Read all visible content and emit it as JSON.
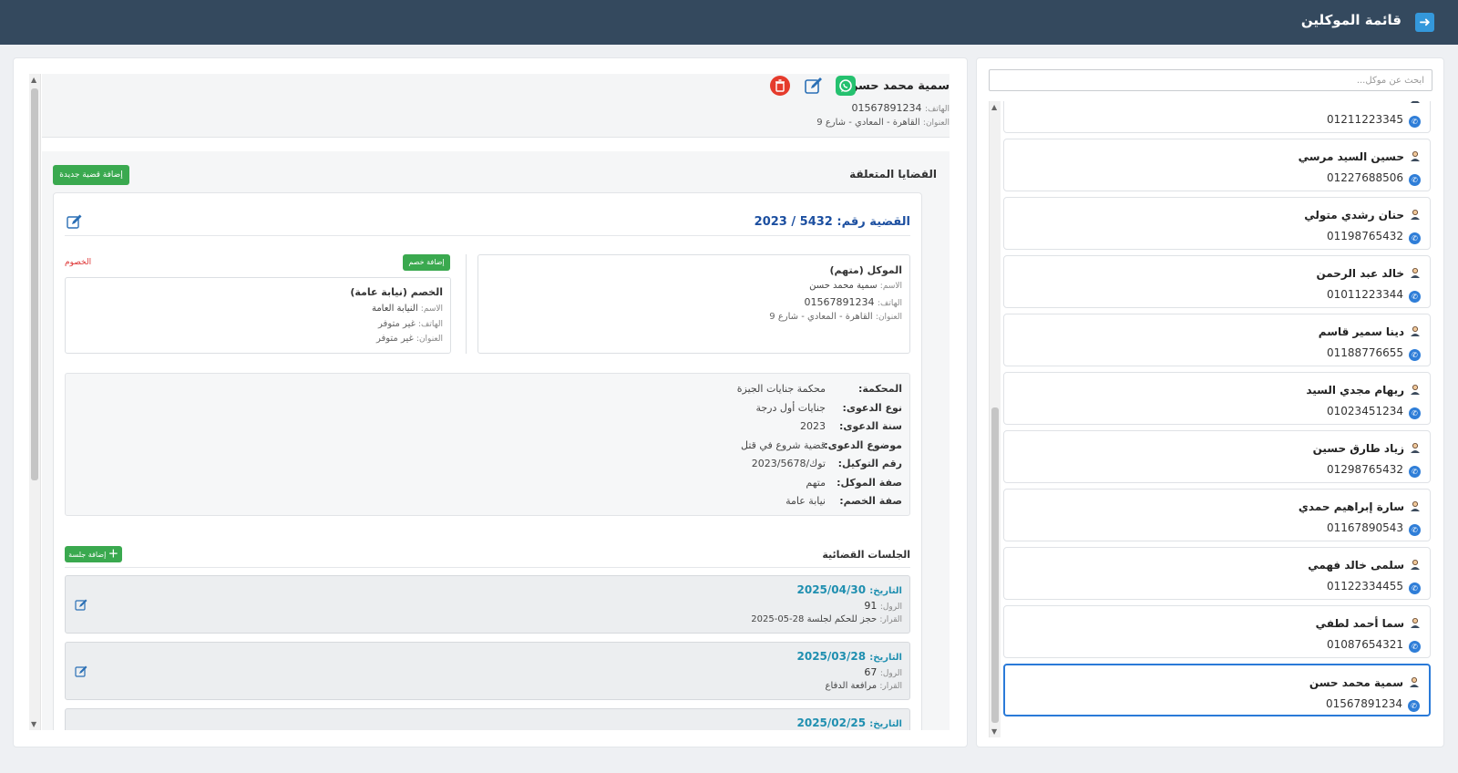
{
  "header": {
    "title": "قائمة الموكلين",
    "logout_icon": "logout-icon"
  },
  "sidebar": {
    "search_placeholder": "ابحث عن موكل...",
    "clients": [
      {
        "name": "",
        "phone": "01211223345"
      },
      {
        "name": "حسين السيد مرسي",
        "phone": "01227688506"
      },
      {
        "name": "حنان رشدي متولي",
        "phone": "01198765432"
      },
      {
        "name": "خالد عبد الرحمن",
        "phone": "01011223344"
      },
      {
        "name": "دينا سمير قاسم",
        "phone": "01188776655"
      },
      {
        "name": "ريهام مجدي السيد",
        "phone": "01023451234"
      },
      {
        "name": "زياد طارق حسين",
        "phone": "01298765432"
      },
      {
        "name": "سارة إبراهيم حمدي",
        "phone": "01167890543"
      },
      {
        "name": "سلمى خالد فهمي",
        "phone": "01122334455"
      },
      {
        "name": "سما أحمد لطفي",
        "phone": "01087654321"
      },
      {
        "name": "سمية محمد حسن",
        "phone": "01567891234",
        "active": true
      }
    ]
  },
  "client": {
    "name": "سمية محمد حسن",
    "phone_label": "الهاتف:",
    "phone": "01567891234",
    "address_label": "العنوان:",
    "address": "القاهرة - المعادي - شارع 9"
  },
  "cases_section": {
    "title": "القضايا المتعلقة",
    "add_case_label": "إضافة قضية جديدة",
    "case": {
      "title_prefix": "القضية رقم:",
      "number": "5432 / 2023",
      "client_box": {
        "title": "الموكل (متهم)",
        "name_label": "الاسم:",
        "name": "سمية محمد حسن",
        "phone_label": "الهاتف:",
        "phone": "01567891234",
        "address_label": "العنوان:",
        "address": "القاهرة - المعادي - شارع 9"
      },
      "opponents_title": "الخصوم",
      "add_opponent_label": "إضافة خصم",
      "opponent_box": {
        "title": "الخصم (نيابة عامة)",
        "name_label": "الاسم:",
        "name": "النيابة العامة",
        "phone_label": "الهاتف:",
        "phone": "غير متوفر",
        "address_label": "العنوان:",
        "address": "غير متوفر"
      },
      "details": [
        {
          "key": "المحكمة:",
          "value": "محكمة جنايات الجيزة"
        },
        {
          "key": "نوع الدعوى:",
          "value": "جنايات أول درجة"
        },
        {
          "key": "سنة الدعوى:",
          "value": "2023"
        },
        {
          "key": "موضوع الدعوى:",
          "value": "قضية شروع في قتل"
        },
        {
          "key": "رقم التوكيل:",
          "value": "توك/2023/5678"
        },
        {
          "key": "صفة الموكل:",
          "value": "متهم"
        },
        {
          "key": "صفة الخصم:",
          "value": "نيابة عامة"
        }
      ],
      "sessions_title": "الجلسات القضائية",
      "add_session_label": "إضافة جلسة",
      "sessions": [
        {
          "date_label": "التاريخ:",
          "date": "2025/04/30",
          "roll_label": "الرول:",
          "roll": "91",
          "decision_label": "القرار:",
          "decision": "حجز للحكم لجلسة 28-05-2025"
        },
        {
          "date_label": "التاريخ:",
          "date": "2025/03/28",
          "roll_label": "الرول:",
          "roll": "67",
          "decision_label": "القرار:",
          "decision": "مرافعة الدفاع"
        },
        {
          "date_label": "التاريخ:",
          "date": "2025/02/25"
        }
      ]
    }
  },
  "colors": {
    "topbar": "#34495e",
    "accent_blue": "#1c4fa0",
    "green": "#3aa94f",
    "whatsapp": "#25c16f",
    "delete_red": "#e53b2c",
    "session_date": "#1f8fb0"
  }
}
